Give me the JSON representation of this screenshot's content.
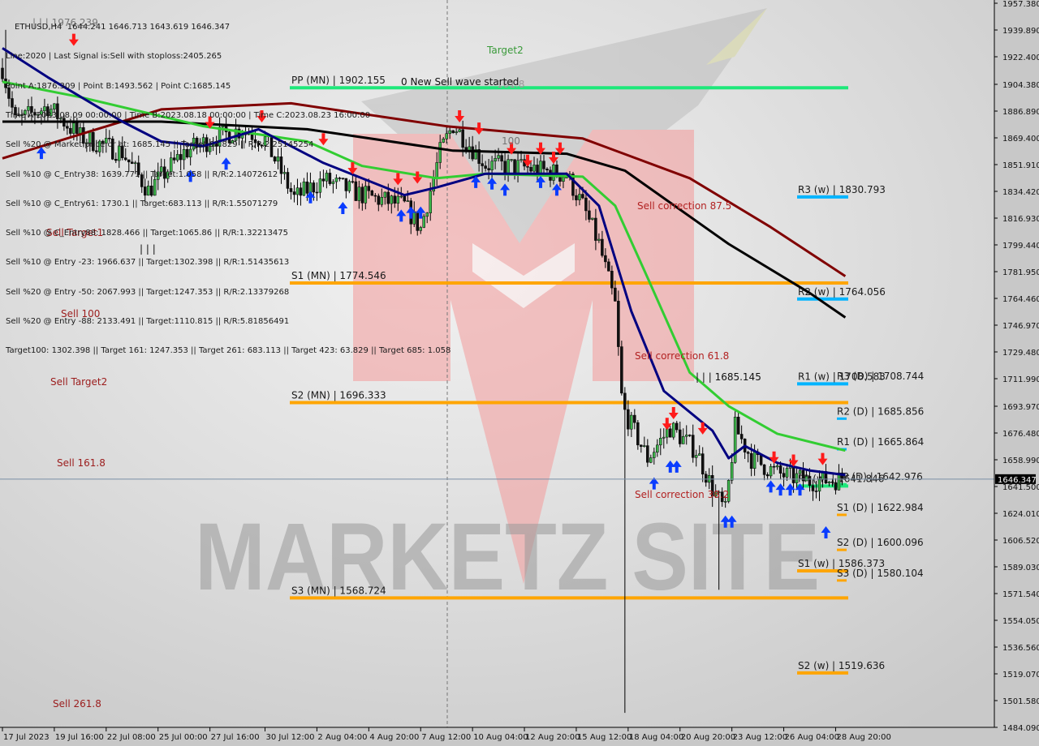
{
  "header": {
    "symbol_line": "ETHUSD,H4  1644.241 1646.713 1643.619 1646.347",
    "info_lines": [
      "Line:2020 | Last Signal is:Sell with stoploss:2405.265",
      "Point A:1876.309 | Point B:1493.562 | Point C:1685.145",
      "Time A:2023.08.09 00:00:00 | Time B:2023.08.18 00:00:00 | Time C:2023.08.23 16:00:00",
      "Sell %20 @ Market price or at: 1685.145 || Target:63.829 || R/R:2.25145254",
      "Sell %10 @ C_Entry38: 1639.771 || Target:1.058 || R/R:2.14072612",
      "Sell %10 @ C_Entry61: 1730.1 || Target:683.113 || R/R:1.55071279",
      "Sell %10 @ C_Entry88: 1828.466 || Target:1065.86 || R/R:1.32213475",
      "Sell %10 @ Entry -23: 1966.637 || Target:1302.398 || R/R:1.51435613",
      "Sell %20 @ Entry -50: 2067.993 || Target:1247.353 || R/R:2.13379268",
      "Sell %20 @ Entry -88: 2133.491 || Target:1110.815 || R/R:5.81856491",
      "Target100: 1302.398 || Target 161: 1247.353 || Target 261: 683.113 || Target 423: 63.829 || Target 685: 1.058"
    ],
    "top_marker": "| | | 1976.239"
  },
  "colors": {
    "background": "#d9d9d9",
    "bull_candle": "#3cb44b",
    "bear_candle": "#111111",
    "buy_arrow": "#0a3cff",
    "sell_arrow": "#ff1a1a",
    "ma_maroon": "#800000",
    "ma_black": "#000000",
    "ma_green": "#32cd32",
    "ma_navy": "#000080",
    "pivot": "#1ee87a",
    "support": "#ffa500",
    "resistance": "#00b4ff",
    "price_line": "#7a8fa6"
  },
  "chart_data": {
    "type": "candlestick",
    "symbol": "ETHUSD",
    "timeframe": "H4",
    "current_price": "1646.347",
    "ylim": [
      1484.09,
      1957.38
    ],
    "y_ticks": [
      "1957.380",
      "1939.890",
      "1922.400",
      "1904.380",
      "1886.890",
      "1869.400",
      "1851.910",
      "1834.420",
      "1816.930",
      "1799.440",
      "1781.950",
      "1764.460",
      "1746.970",
      "1729.480",
      "1711.990",
      "1693.970",
      "1676.480",
      "1658.990",
      "1641.500",
      "1624.010",
      "1606.520",
      "1589.030",
      "1571.540",
      "1554.050",
      "1536.560",
      "1519.070",
      "1501.580",
      "1484.090"
    ],
    "x_ticks": [
      {
        "label": "17 Jul 2023",
        "time": "2023-07-17 00:00"
      },
      {
        "label": "19 Jul 16:00",
        "time": "2023-07-19 16:00"
      },
      {
        "label": "22 Jul 08:00",
        "time": "2023-07-22 08:00"
      },
      {
        "label": "25 Jul 00:00",
        "time": "2023-07-25 00:00"
      },
      {
        "label": "27 Jul 16:00",
        "time": "2023-07-27 16:00"
      },
      {
        "label": "30 Jul 12:00",
        "time": "2023-07-30 12:00"
      },
      {
        "label": "2 Aug 04:00",
        "time": "2023-08-02 04:00"
      },
      {
        "label": "4 Aug 20:00",
        "time": "2023-08-04 20:00"
      },
      {
        "label": "7 Aug 12:00",
        "time": "2023-08-07 12:00"
      },
      {
        "label": "10 Aug 04:00",
        "time": "2023-08-10 04:00"
      },
      {
        "label": "12 Aug 20:00",
        "time": "2023-08-12 20:00"
      },
      {
        "label": "15 Aug 12:00",
        "time": "2023-08-15 12:00"
      },
      {
        "label": "18 Aug 04:00",
        "time": "2023-08-18 04:00"
      },
      {
        "label": "20 Aug 20:00",
        "time": "2023-08-20 20:00"
      },
      {
        "label": "23 Aug 12:00",
        "time": "2023-08-23 12:00"
      },
      {
        "label": "26 Aug 04:00",
        "time": "2023-08-26 04:00"
      },
      {
        "label": "28 Aug 20:00",
        "time": "2023-08-28 20:00"
      }
    ],
    "approx_close_path": [
      [
        "2023-07-17 00:00",
        1915
      ],
      [
        "2023-07-17 16:00",
        1880
      ],
      [
        "2023-07-19 08:00",
        1890
      ],
      [
        "2023-07-21 00:00",
        1870
      ],
      [
        "2023-07-23 04:00",
        1860
      ],
      [
        "2023-07-24 12:00",
        1835
      ],
      [
        "2023-07-26 08:00",
        1860
      ],
      [
        "2023-07-28 00:00",
        1870
      ],
      [
        "2023-07-29 08:00",
        1875
      ],
      [
        "2023-07-30 12:00",
        1868
      ],
      [
        "2023-08-01 00:00",
        1830
      ],
      [
        "2023-08-02 12:00",
        1842
      ],
      [
        "2023-08-04 12:00",
        1832
      ],
      [
        "2023-08-06 16:00",
        1825
      ],
      [
        "2023-08-07 12:00",
        1810
      ],
      [
        "2023-08-08 12:00",
        1860
      ],
      [
        "2023-08-09 04:00",
        1878
      ],
      [
        "2023-08-10 20:00",
        1852
      ],
      [
        "2023-08-12 20:00",
        1850
      ],
      [
        "2023-08-15 00:00",
        1845
      ],
      [
        "2023-08-15 20:00",
        1825
      ],
      [
        "2023-08-16 16:00",
        1800
      ],
      [
        "2023-08-17 12:00",
        1760
      ],
      [
        "2023-08-17 20:00",
        1700
      ],
      [
        "2023-08-18 00:00",
        1690
      ],
      [
        "2023-08-19 04:00",
        1660
      ],
      [
        "2023-08-20 08:00",
        1680
      ],
      [
        "2023-08-21 16:00",
        1665
      ],
      [
        "2023-08-22 12:00",
        1640
      ],
      [
        "2023-08-23 04:00",
        1625
      ],
      [
        "2023-08-23 16:00",
        1680
      ],
      [
        "2023-08-24 12:00",
        1660
      ],
      [
        "2023-08-25 20:00",
        1650
      ],
      [
        "2023-08-27 12:00",
        1645
      ],
      [
        "2023-08-29 04:00",
        1646.347
      ]
    ],
    "extreme_wicks": [
      {
        "time": "2023-08-18 00:00",
        "low": 1493.562
      },
      {
        "time": "2023-08-22 20:00",
        "low": 1574
      },
      {
        "time": "2023-07-17 04:00",
        "high": 1940
      }
    ],
    "moving_averages": [
      {
        "color_key": "ma_maroon",
        "points": [
          [
            "2023-07-17 00:00",
            1856
          ],
          [
            "2023-07-25 04:00",
            1888
          ],
          [
            "2023-07-31 20:00",
            1892
          ],
          [
            "2023-08-08 20:00",
            1877
          ],
          [
            "2023-08-15 20:00",
            1869
          ],
          [
            "2023-08-21 08:00",
            1843
          ],
          [
            "2023-08-25 12:00",
            1811
          ],
          [
            "2023-08-29 08:00",
            1779
          ]
        ]
      },
      {
        "color_key": "ma_black",
        "points": [
          [
            "2023-07-17 00:00",
            1880
          ],
          [
            "2023-07-25 04:00",
            1880
          ],
          [
            "2023-08-01 16:00",
            1875
          ],
          [
            "2023-08-09 04:00",
            1861
          ],
          [
            "2023-08-15 00:00",
            1859
          ],
          [
            "2023-08-18 00:00",
            1848
          ],
          [
            "2023-08-23 08:00",
            1800
          ],
          [
            "2023-08-27 12:00",
            1768
          ],
          [
            "2023-08-29 08:00",
            1752
          ]
        ]
      },
      {
        "color_key": "ma_green",
        "points": [
          [
            "2023-07-17 00:00",
            1906
          ],
          [
            "2023-07-21 00:00",
            1896
          ],
          [
            "2023-07-27 08:00",
            1877
          ],
          [
            "2023-08-01 16:00",
            1867
          ],
          [
            "2023-08-04 12:00",
            1851
          ],
          [
            "2023-08-08 08:00",
            1843
          ],
          [
            "2023-08-10 20:00",
            1846
          ],
          [
            "2023-08-15 20:00",
            1844
          ],
          [
            "2023-08-17 12:00",
            1825
          ],
          [
            "2023-08-19 04:00",
            1778
          ],
          [
            "2023-08-21 08:00",
            1716
          ],
          [
            "2023-08-23 08:00",
            1694
          ],
          [
            "2023-08-25 20:00",
            1676
          ],
          [
            "2023-08-29 08:00",
            1665
          ]
        ]
      },
      {
        "color_key": "ma_navy",
        "points": [
          [
            "2023-07-17 00:00",
            1928
          ],
          [
            "2023-07-19 08:00",
            1909
          ],
          [
            "2023-07-23 04:00",
            1880
          ],
          [
            "2023-07-25 04:00",
            1867
          ],
          [
            "2023-07-27 08:00",
            1864
          ],
          [
            "2023-07-30 04:00",
            1875
          ],
          [
            "2023-08-02 12:00",
            1853
          ],
          [
            "2023-08-06 16:00",
            1832
          ],
          [
            "2023-08-08 08:00",
            1837
          ],
          [
            "2023-08-10 20:00",
            1846
          ],
          [
            "2023-08-15 00:00",
            1846
          ],
          [
            "2023-08-16 16:00",
            1825
          ],
          [
            "2023-08-18 08:00",
            1756
          ],
          [
            "2023-08-20 00:00",
            1704
          ],
          [
            "2023-08-22 12:00",
            1678
          ],
          [
            "2023-08-23 08:00",
            1660
          ],
          [
            "2023-08-24 04:00",
            1668
          ],
          [
            "2023-08-25 20:00",
            1657
          ],
          [
            "2023-08-27 12:00",
            1652
          ],
          [
            "2023-08-29 08:00",
            1649
          ]
        ]
      }
    ],
    "signals": {
      "sell": [
        [
          "2023-07-20 16:00",
          1930
        ],
        [
          "2023-07-27 16:00",
          1876
        ],
        [
          "2023-07-30 08:00",
          1880
        ],
        [
          "2023-08-02 12:00",
          1865
        ],
        [
          "2023-08-04 00:00",
          1846
        ],
        [
          "2023-08-06 08:00",
          1839
        ],
        [
          "2023-08-07 08:00",
          1840
        ],
        [
          "2023-08-09 12:00",
          1880
        ],
        [
          "2023-08-10 12:00",
          1872
        ],
        [
          "2023-08-12 04:00",
          1859
        ],
        [
          "2023-08-13 00:00",
          1851
        ],
        [
          "2023-08-13 16:00",
          1859
        ],
        [
          "2023-08-14 08:00",
          1853
        ],
        [
          "2023-08-14 16:00",
          1859
        ],
        [
          "2023-08-20 04:00",
          1679
        ],
        [
          "2023-08-20 12:00",
          1686
        ],
        [
          "2023-08-22 00:00",
          1676
        ],
        [
          "2023-08-25 16:00",
          1657
        ],
        [
          "2023-08-26 16:00",
          1655
        ],
        [
          "2023-08-28 04:00",
          1656
        ]
      ],
      "buy": [
        [
          "2023-07-19 00:00",
          1863
        ],
        [
          "2023-07-26 16:00",
          1848
        ],
        [
          "2023-07-28 12:00",
          1856
        ],
        [
          "2023-08-01 20:00",
          1834
        ],
        [
          "2023-08-03 12:00",
          1827
        ],
        [
          "2023-08-06 12:00",
          1822
        ],
        [
          "2023-08-07 00:00",
          1824
        ],
        [
          "2023-08-07 12:00",
          1824
        ],
        [
          "2023-08-10 08:00",
          1844
        ],
        [
          "2023-08-11 04:00",
          1843
        ],
        [
          "2023-08-11 20:00",
          1839
        ],
        [
          "2023-08-13 16:00",
          1844
        ],
        [
          "2023-08-14 12:00",
          1839
        ],
        [
          "2023-08-19 12:00",
          1647
        ],
        [
          "2023-08-20 08:00",
          1658
        ],
        [
          "2023-08-20 16:00",
          1658
        ],
        [
          "2023-08-23 04:00",
          1622
        ],
        [
          "2023-08-23 12:00",
          1622
        ],
        [
          "2023-08-25 12:00",
          1645
        ],
        [
          "2023-08-26 00:00",
          1643
        ],
        [
          "2023-08-26 12:00",
          1643
        ],
        [
          "2023-08-27 00:00",
          1643
        ],
        [
          "2023-08-28 08:00",
          1615
        ]
      ]
    },
    "levels": [
      {
        "label": "PP (MN) | 1902.155",
        "price": 1902.155,
        "period": "monthly",
        "kind": "pivot"
      },
      {
        "label": "S1 (MN) | 1774.546",
        "price": 1774.546,
        "period": "monthly",
        "kind": "support"
      },
      {
        "label": "S2 (MN) | 1696.333",
        "price": 1696.333,
        "period": "monthly",
        "kind": "support"
      },
      {
        "label": "S3 (MN) | 1568.724",
        "price": 1568.724,
        "period": "monthly",
        "kind": "support"
      },
      {
        "label": "R3 (w) | 1830.793",
        "price": 1830.793,
        "period": "weekly",
        "kind": "resistance"
      },
      {
        "label": "R2 (w) | 1764.056",
        "price": 1764.056,
        "period": "weekly",
        "kind": "resistance"
      },
      {
        "label": "R1 (w) | 1708.583",
        "price": 1708.583,
        "period": "weekly",
        "kind": "resistance"
      },
      {
        "label": "PP (w) | 1641.846",
        "price": 1641.846,
        "period": "weekly",
        "kind": "pivot"
      },
      {
        "label": "S1 (w) | 1586.373",
        "price": 1586.373,
        "period": "weekly",
        "kind": "support"
      },
      {
        "label": "S2 (w) | 1519.636",
        "price": 1519.636,
        "period": "weekly",
        "kind": "support"
      },
      {
        "label": "R3 (D) | 1708.744",
        "price": 1708.744,
        "period": "daily",
        "kind": "resistance"
      },
      {
        "label": "R2 (D) | 1685.856",
        "price": 1685.856,
        "period": "daily",
        "kind": "resistance"
      },
      {
        "label": "R1 (D) | 1665.864",
        "price": 1665.864,
        "period": "daily",
        "kind": "resistance"
      },
      {
        "label": "PP (D) | 1642.976",
        "price": 1642.976,
        "period": "daily",
        "kind": "pivot"
      },
      {
        "label": "S1 (D) | 1622.984",
        "price": 1622.984,
        "period": "daily",
        "kind": "support"
      },
      {
        "label": "S2 (D) | 1600.096",
        "price": 1600.096,
        "period": "daily",
        "kind": "support"
      },
      {
        "label": "S3 (D) | 1580.104",
        "price": 1580.104,
        "period": "daily",
        "kind": "support"
      }
    ],
    "annotations": {
      "sell_target1": "Sell Target1",
      "sell_100": "Sell 100",
      "sell_target2": "Sell Target2",
      "sell_161": "Sell 161.8",
      "sell_261": "Sell  261.8",
      "target2": "Target2",
      "new_wave": "0 New Sell wave started",
      "fib_161": "161.8",
      "fib_100": "100",
      "corr_875": "Sell correction 87.5",
      "corr_618": "Sell correction 61.8",
      "corr_382": "Sell correction 38.2",
      "point_c_marker": "| | | 1685.145",
      "tick_marker": "| | |"
    },
    "watermark": "MARKETZ SITE"
  }
}
